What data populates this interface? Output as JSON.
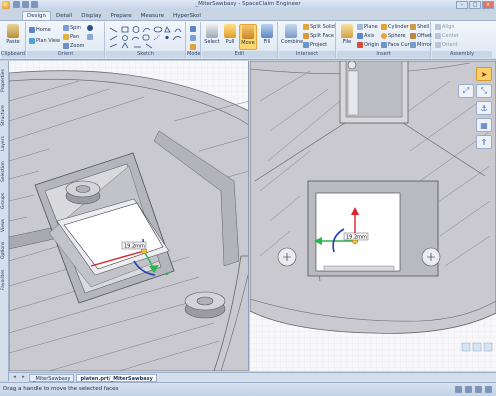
{
  "window": {
    "title": "_MiterSawbasy - SpaceClaim Engineer",
    "controls": {
      "minimize": "–",
      "maximize": "□",
      "close": "×"
    }
  },
  "ribbon_tabs": [
    "Design",
    "Detail",
    "Display",
    "Prepare",
    "Measure",
    "HyperSkol"
  ],
  "ribbon": {
    "groups": {
      "clipboard": "Clipboard",
      "orient": "Orient",
      "sketch": "Sketch",
      "mode": "Mode",
      "edit": "Edit",
      "intersect": "Intersect",
      "insert": "Insert",
      "assembly": "Assembly"
    },
    "clipboard": {
      "paste": "Paste"
    },
    "orient": {
      "home": "Home",
      "plan_view": "Plan View",
      "spin": "Spin",
      "pan": "Pan",
      "zoom": "Zoom"
    },
    "edit": {
      "select": "Select",
      "pull": "Pull",
      "move": "Move",
      "fill": "Fill"
    },
    "intersect": {
      "combine": "Combine",
      "split_solid": "Split Solid",
      "split_face": "Split Face",
      "project": "Project"
    },
    "insert": {
      "file": "File",
      "plane": "Plane",
      "axis": "Axis",
      "origin": "Origin",
      "cylinder": "Cylinder",
      "sphere": "Sphere",
      "face_curve": "Face Curve",
      "shell": "Shell",
      "offset": "Offset",
      "mirror": "Mirror"
    },
    "assembly": {
      "align": "Align",
      "center": "Center",
      "orient": "Orient"
    }
  },
  "side_panel_tabs": [
    "Properties",
    "Structure",
    "Layers",
    "Selection",
    "Groups",
    "Views",
    "Options",
    "Favorites"
  ],
  "viewport_left": {
    "dimension": "19.2mm"
  },
  "viewport_right": {
    "dimension": "19.2mm"
  },
  "document_tabs": [
    "_MiterSawbasy",
    "platen.prt/_MiterSawbasy"
  ],
  "status": {
    "message": "Drag a handle to move the selected faces"
  },
  "colors": {
    "pressed": "#fbd76f",
    "x_axis": "#d8242a",
    "y_axis": "#2bb44a",
    "z_axis": "#1f3fb0"
  }
}
